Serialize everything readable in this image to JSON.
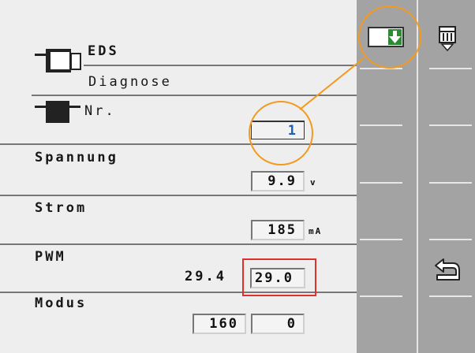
{
  "header": {
    "title": "EDS",
    "subtitle": "Diagnose"
  },
  "fields": {
    "nr": {
      "label": "Nr.",
      "value": "1"
    },
    "spannung": {
      "label": "Spannung",
      "value": "9.9",
      "unit": "v"
    },
    "strom": {
      "label": "Strom",
      "value": "185",
      "unit": "mA"
    },
    "pwm": {
      "label": "PWM",
      "actual": "29.4",
      "value": "29.0"
    },
    "modus": {
      "label": "Modus",
      "value1": "160",
      "value2": "0"
    }
  },
  "softkeys": {
    "save_icon": "save-to-memory-icon",
    "device_icon": "connector-icon",
    "back_icon": "return-icon"
  },
  "colors": {
    "value_highlight": "#1e5fb4",
    "callout": "#f39a1e",
    "highlight_rect": "#e0302a",
    "softkey_bar": "#a3a3a3"
  }
}
